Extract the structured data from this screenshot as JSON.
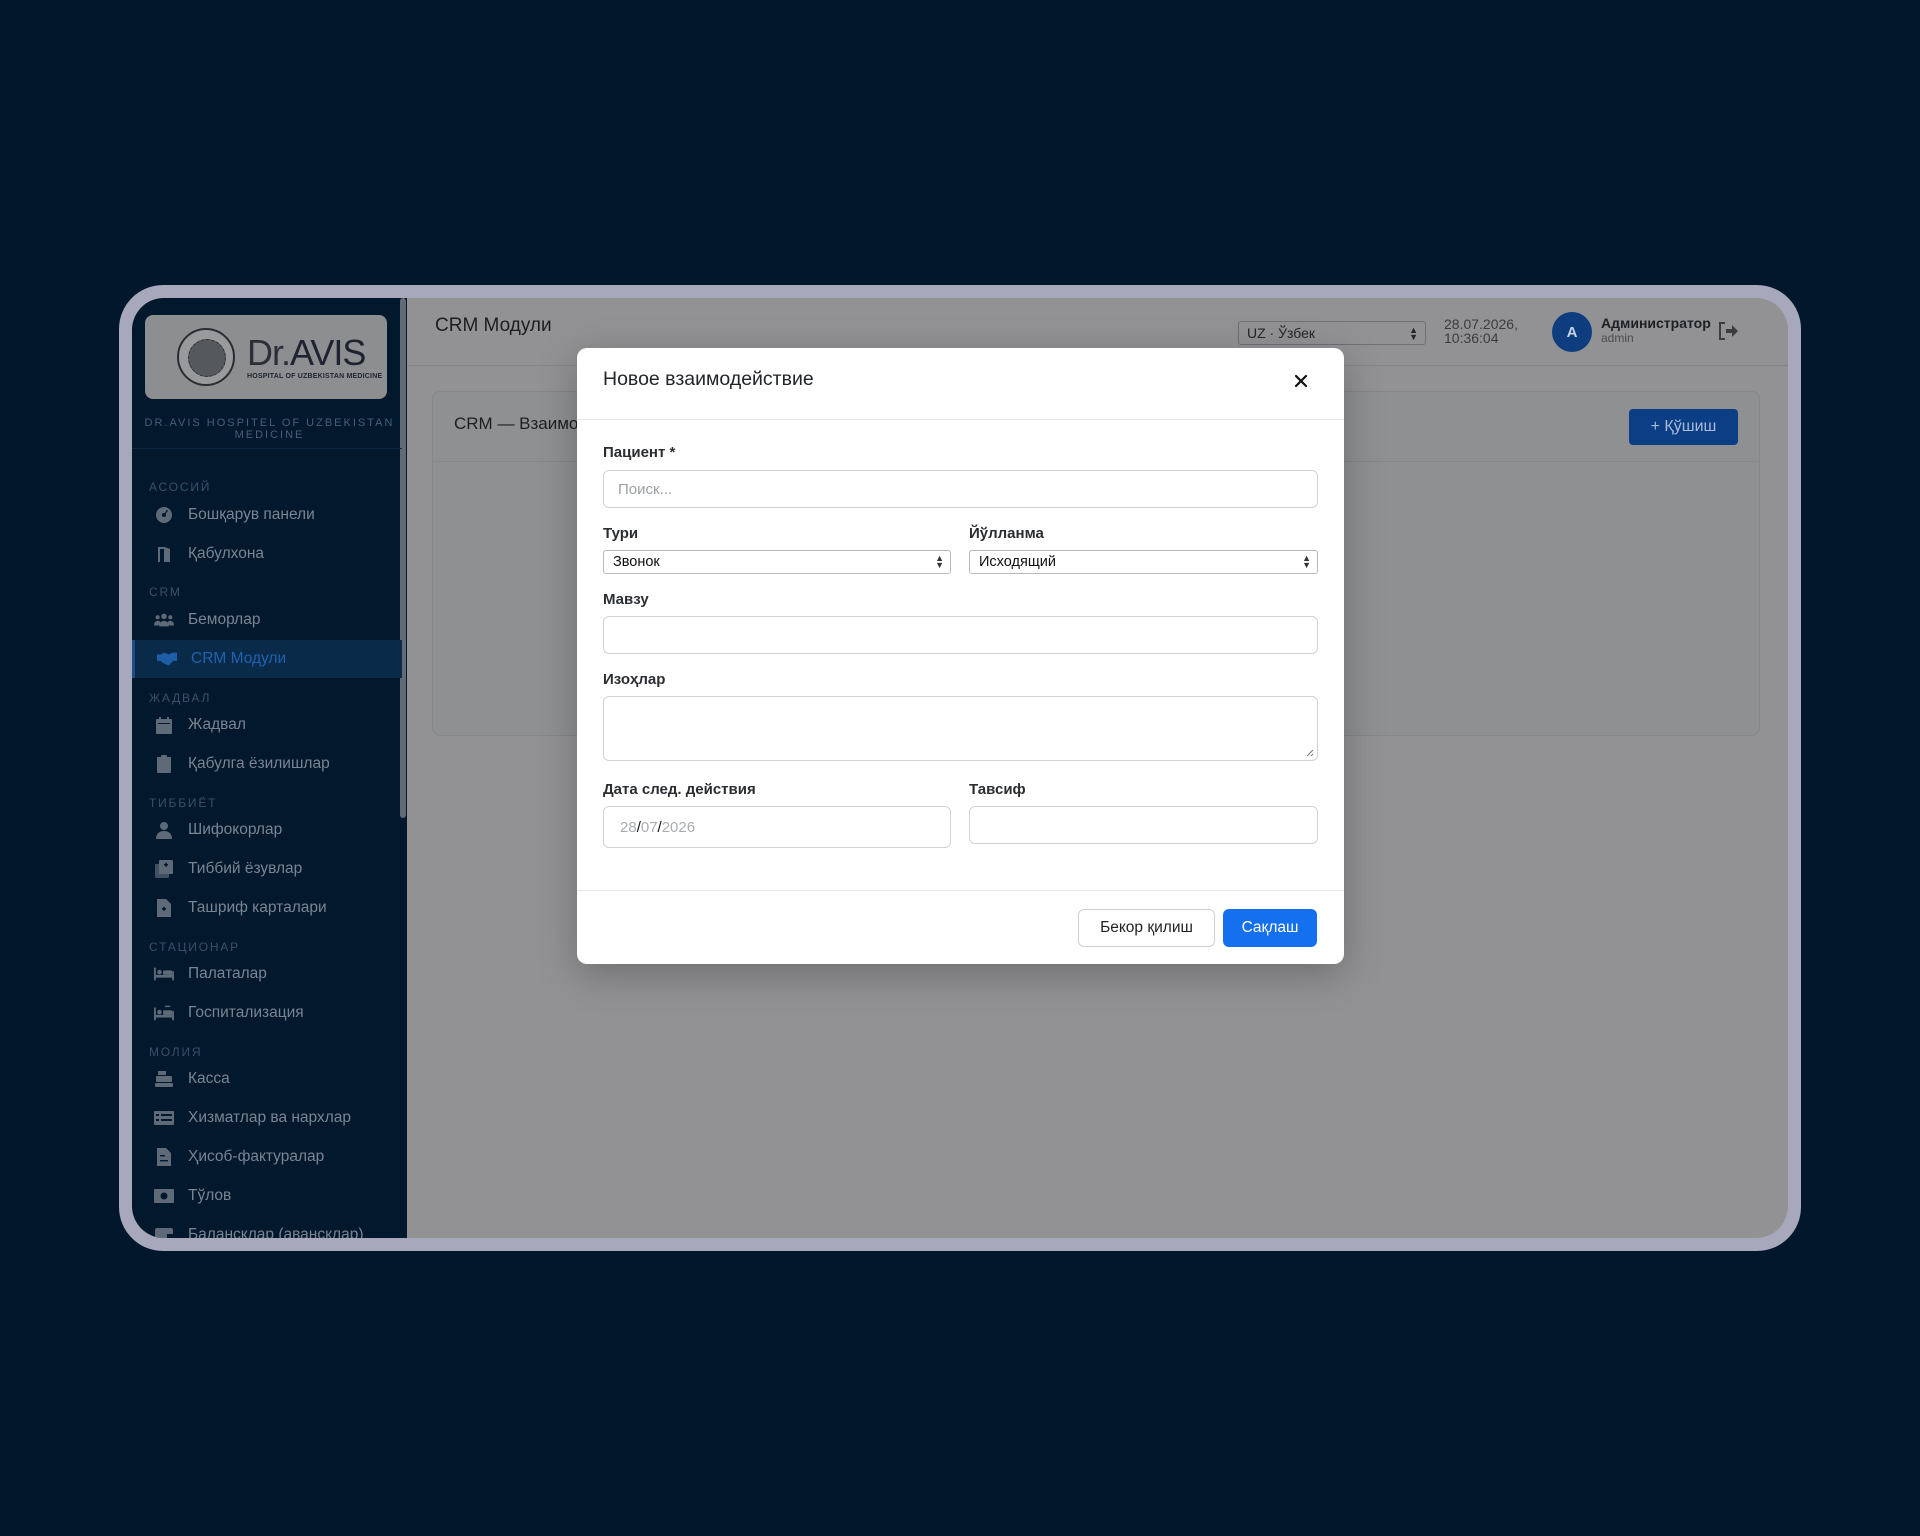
{
  "brand": {
    "logo_dr": "Dr.",
    "logo_avis": "AVIS",
    "logo_tagline": "HOSPITAL OF UZBEKISTAN MEDICINE",
    "subtitle": "DR.AVIS HOSPITEL OF UZBEKISTAN MEDICINE"
  },
  "sidebar": {
    "sections": [
      {
        "title": "АСОСИЙ",
        "items": [
          {
            "label": "Бошқарув панели",
            "icon": "dashboard-icon"
          },
          {
            "label": "Қабулхона",
            "icon": "door-icon"
          }
        ]
      },
      {
        "title": "CRM",
        "items": [
          {
            "label": "Беморлар",
            "icon": "users-icon"
          },
          {
            "label": "CRM Модули",
            "icon": "handshake-icon",
            "active": true
          }
        ]
      },
      {
        "title": "ЖАДВАЛ",
        "items": [
          {
            "label": "Жадвал",
            "icon": "calendar-icon"
          },
          {
            "label": "Қабулга ёзилишлар",
            "icon": "clipboard-icon"
          }
        ]
      },
      {
        "title": "ТИББИЁТ",
        "items": [
          {
            "label": "Шифокорлар",
            "icon": "doctor-icon"
          },
          {
            "label": "Тиббий ёзувлар",
            "icon": "medical-records-icon"
          },
          {
            "label": "Ташриф карталари",
            "icon": "file-medical-icon"
          }
        ]
      },
      {
        "title": "СТАЦИОНАР",
        "items": [
          {
            "label": "Палаталар",
            "icon": "bed-icon"
          },
          {
            "label": "Госпитализация",
            "icon": "hospital-bed-icon"
          }
        ]
      },
      {
        "title": "МОЛИЯ",
        "items": [
          {
            "label": "Касса",
            "icon": "cash-register-icon"
          },
          {
            "label": "Хизматлар ва нархлар",
            "icon": "list-icon"
          },
          {
            "label": "Ҳисоб-фактуралар",
            "icon": "invoice-icon"
          },
          {
            "label": "Тўлов",
            "icon": "money-icon"
          },
          {
            "label": "Балансклар (авансклар)",
            "icon": "wallet-icon"
          }
        ]
      }
    ]
  },
  "header": {
    "title": "CRM Модули",
    "language": "UZ · Ўзбек",
    "date": "28.07.2026,",
    "time": "10:36:04",
    "avatar_letter": "A",
    "user_name": "Администратор",
    "user_role": "admin"
  },
  "card": {
    "title": "CRM — Взаимо",
    "add_button": "+ Қўшиш"
  },
  "modal": {
    "title": "Новое взаимодействие",
    "patient_label": "Пациент *",
    "patient_placeholder": "Поиск...",
    "type_label": "Тури",
    "type_value": "Звонок",
    "direction_label": "Йўлланма",
    "direction_value": "Исходящий",
    "subject_label": "Мавзу",
    "notes_label": "Изоҳлар",
    "next_date_label": "Дата след. действия",
    "next_date_day": "28",
    "next_date_month": "07",
    "next_date_year": "2026",
    "description_label": "Тавсиф",
    "cancel_button": "Бекор қилиш",
    "save_button": "Сақлаш"
  }
}
